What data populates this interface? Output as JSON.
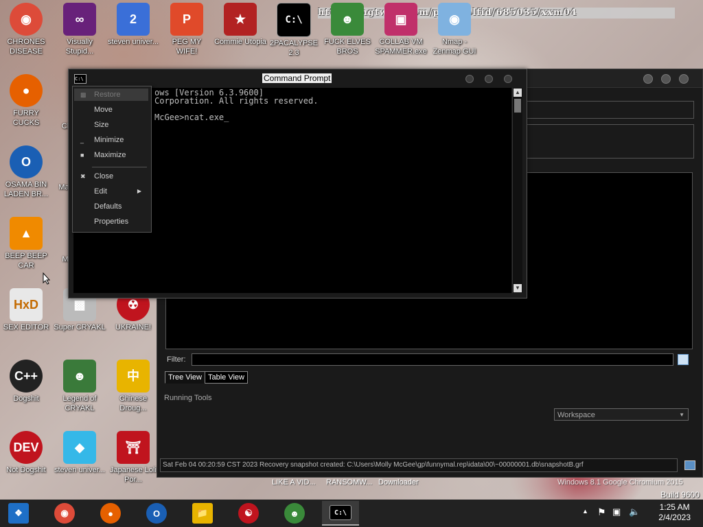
{
  "desktop_icons": [
    {
      "label": "CHRONES DISEASE",
      "icon": "chrome-icon",
      "color": "#dd4b39"
    },
    {
      "label": "Visually Stupid...",
      "icon": "visual-studio-icon",
      "color": "#68217a"
    },
    {
      "label": "steven univer...",
      "icon": "steven-universe-icon",
      "color": "#3a6fd8"
    },
    {
      "label": "PEG MY WIFE!",
      "icon": "peg-icon",
      "color": "#e04a2a"
    },
    {
      "label": "Commie Utopia",
      "icon": "commie-icon",
      "color": "#b22222"
    },
    {
      "label": "2PACALYPSE 2.3",
      "icon": "cmd-icon",
      "color": "#000000"
    },
    {
      "label": "FUCK ELVES BROS",
      "icon": "elf-icon",
      "color": "#3a8a3a"
    },
    {
      "label": "COLLAB VM SPAMMER.exe",
      "icon": "monitor-icon",
      "color": "#c0306a"
    },
    {
      "label": "Nmap - Zenmap GUI",
      "icon": "eye-icon",
      "color": "#7fb2e0"
    },
    {
      "label": "FURRY CUCKS",
      "icon": "firefox-icon",
      "color": "#e66000"
    },
    {
      "label": "OSAMA BIN LADEN BR...",
      "icon": "obama-logo-icon",
      "color": "#1a5fb4"
    },
    {
      "label": "BEEP BEEP CAR",
      "icon": "vlc-icon",
      "color": "#f08a00"
    },
    {
      "label": "SEX EDITOR",
      "icon": "hxd-icon",
      "color": "#e8e8e8"
    },
    {
      "label": "Super CRYAKL",
      "icon": "pixel-cat-icon",
      "color": "#bbbbbb"
    },
    {
      "label": "UKRAINE!",
      "icon": "radiation-icon",
      "color": "#c0141e"
    },
    {
      "label": "Dogshit",
      "icon": "codeblocks-icon",
      "color": "#222222"
    },
    {
      "label": "Legend of CRYAKL",
      "icon": "pixel-character-icon",
      "color": "#3a7a3a"
    },
    {
      "label": "Chinese Droug...",
      "icon": "mahjong-icon",
      "color": "#e8b400"
    },
    {
      "label": "Not Dogshit",
      "icon": "devcpp-icon",
      "color": "#c0141e"
    },
    {
      "label": "steven univer...",
      "icon": "diamond-icon",
      "color": "#35b8e8"
    },
    {
      "label": "Japanese Loli Por...",
      "icon": "torii-icon",
      "color": "#c0141e"
    }
  ],
  "partial_icon_labels": [
    "Cl",
    "Ma",
    "M"
  ],
  "url_overlay": "http://imgtwist.com/p/Gogolfid/685035/xxm04",
  "cmd": {
    "title": "Command Prompt",
    "lines": [
      "ows [Version 6.3.9600]",
      "Corporation. All rights reserved.",
      "",
      "McGee>ncat.exe_"
    ],
    "system_menu": [
      {
        "label": "Restore",
        "enabled": false,
        "selected": true
      },
      {
        "label": "Move",
        "enabled": true
      },
      {
        "label": "Size",
        "enabled": true
      },
      {
        "label": "Minimize",
        "enabled": true
      },
      {
        "label": "Maximize",
        "enabled": true
      },
      {
        "label": "Close",
        "enabled": true
      },
      {
        "label": "Edit",
        "enabled": true,
        "submenu": true
      },
      {
        "label": "Defaults",
        "enabled": true
      },
      {
        "label": "Properties",
        "enabled": true
      }
    ]
  },
  "zenmap": {
    "filter_label": "Filter:",
    "tabs": [
      "Tree View",
      "Table View"
    ],
    "running_tools_label": "Running Tools",
    "workspace_value": "Workspace",
    "status_text": "Sat Feb 04 00:20:59 CST 2023 Recovery snapshot created: C:\\Users\\Molly McGee\\gp\\funnymal.rep\\idata\\00\\~00000001.db\\snapshotB.grf"
  },
  "background_labels": [
    "LIKE A VID...",
    "RANSOMW...",
    "Downloader"
  ],
  "watermark": {
    "edition": "Windows 8.1 Google Chromium 2015",
    "build": "Build 9600"
  },
  "taskbar": {
    "items": [
      "start-icon",
      "chrome-icon",
      "firefox-icon",
      "obama-logo-icon",
      "file-explorer-icon",
      "ghidra-dragon-icon",
      "elf-icon",
      "cmd-icon"
    ],
    "clock_time": "1:25 AM",
    "clock_date": "2/4/2023"
  }
}
